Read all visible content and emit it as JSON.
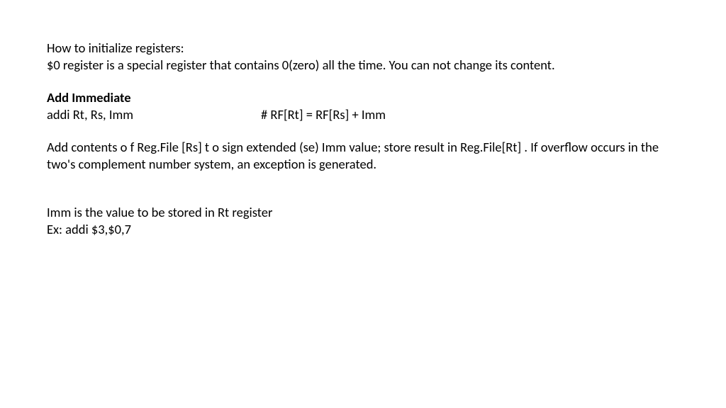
{
  "slide": {
    "line1": "How to initialize registers:",
    "line2": "$0 register is a special register that contains 0(zero) all the time.  You can not change its content.",
    "heading": "Add Immediate",
    "instr_left": "addi Rt, Rs, Imm",
    "instr_right": "# RF[Rt] = RF[Rs] + Imm",
    "desc": "Add contents o f Reg.File [Rs] t o sign extended (se) Imm value; store result in Reg.File[Rt] . If overflow occurs in the two's complement number system, an exception is generated.",
    "imm_line": "Imm is the value to be stored in Rt register",
    "ex_line": "Ex: addi $3,$0,7"
  }
}
